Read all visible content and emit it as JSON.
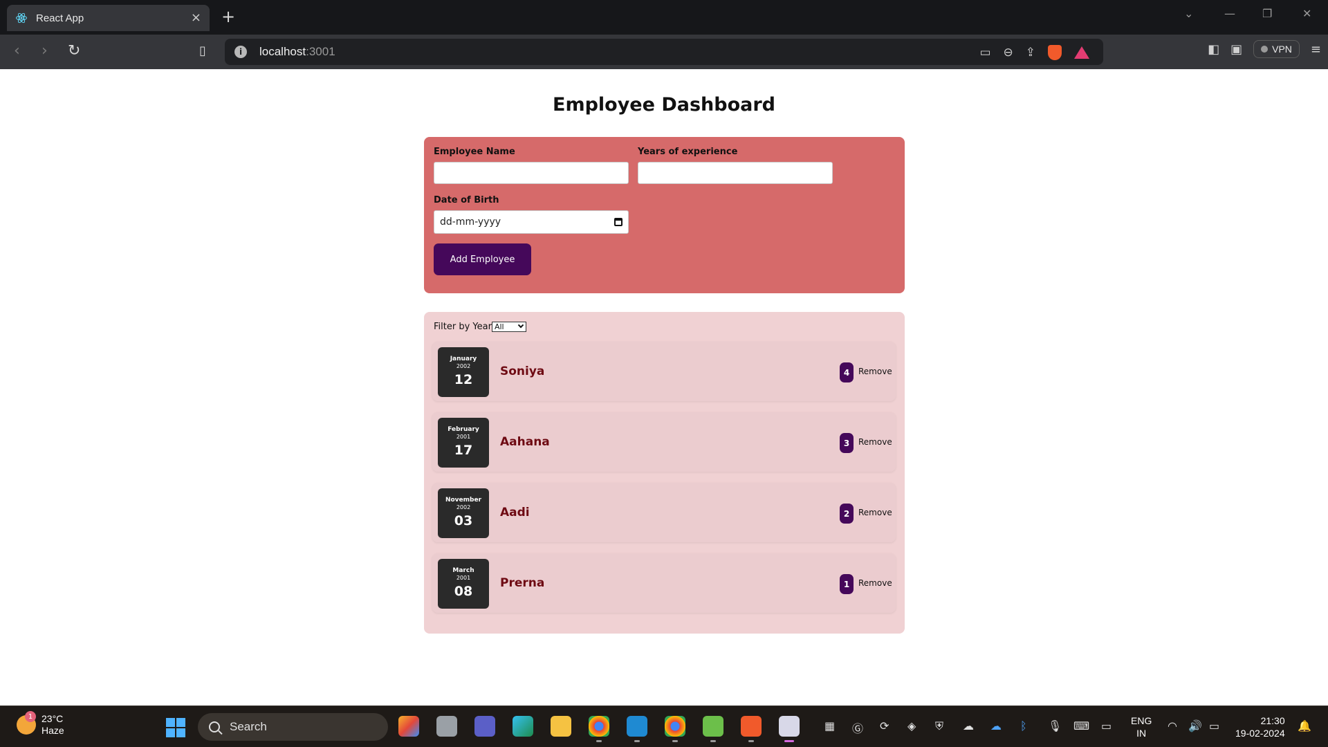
{
  "browser": {
    "tab_title": "React App",
    "url_host": "localhost",
    "url_port": ":3001",
    "vpn_label": "VPN"
  },
  "page": {
    "title": "Employee Dashboard"
  },
  "form": {
    "name_label": "Employee Name",
    "name_value": "",
    "experience_label": "Years of experience",
    "experience_value": "",
    "dob_label": "Date of Birth",
    "dob_placeholder": "dd-mm-yyyy",
    "submit_label": "Add Employee"
  },
  "filter": {
    "label": "Filter by Year",
    "selected": "All"
  },
  "employees": [
    {
      "month": "January",
      "year": "2002",
      "day": "12",
      "name": "Soniya",
      "experience": "4",
      "remove_label": "Remove"
    },
    {
      "month": "February",
      "year": "2001",
      "day": "17",
      "name": "Aahana",
      "experience": "3",
      "remove_label": "Remove"
    },
    {
      "month": "November",
      "year": "2002",
      "day": "03",
      "name": "Aadi",
      "experience": "2",
      "remove_label": "Remove"
    },
    {
      "month": "March",
      "year": "2001",
      "day": "08",
      "name": "Prerna",
      "experience": "1",
      "remove_label": "Remove"
    }
  ],
  "colors": {
    "form_card": "#d66a6a",
    "list_card": "#f0d1d3",
    "accent": "#45085a",
    "name_text": "#6e0a13"
  },
  "taskbar": {
    "weather_temp": "23°C",
    "weather_desc": "Haze",
    "weather_badge": "1",
    "search_label": "Search",
    "lang_line1": "ENG",
    "lang_line2": "IN",
    "time": "21:30",
    "date": "19-02-2024"
  }
}
